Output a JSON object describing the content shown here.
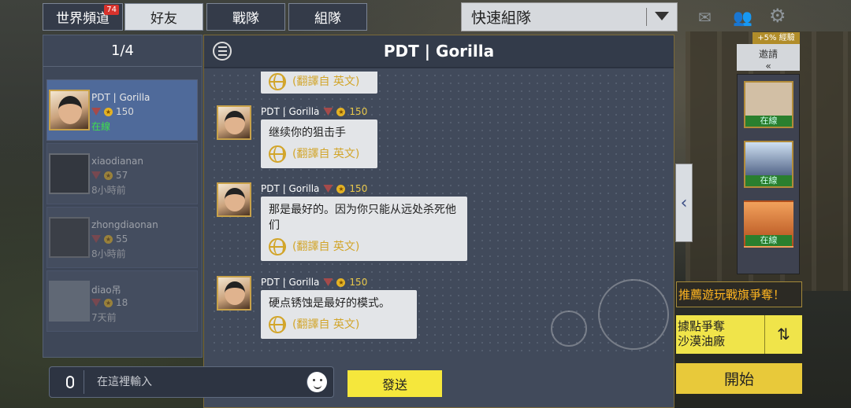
{
  "tabs": [
    {
      "label": "世界頻道",
      "badge": "74"
    },
    {
      "label": "好友"
    },
    {
      "label": "戰隊"
    },
    {
      "label": "組隊"
    }
  ],
  "quick_team": {
    "label": "快速組隊"
  },
  "friends_panel": {
    "page": "1/4",
    "friends": [
      {
        "name": "PDT | Gorilla",
        "level": "150",
        "status": "在線"
      },
      {
        "name": "xiaodianan",
        "level": "57",
        "status": "8小時前"
      },
      {
        "name": "zhongdiaonan",
        "level": "55",
        "status": "8小時前"
      },
      {
        "name": "diao吊",
        "level": "18",
        "status": "7天前"
      }
    ]
  },
  "chat": {
    "title": "PDT | Gorilla",
    "partial_translation": "(翻譯自 英文)",
    "messages": [
      {
        "sender": "PDT | Gorilla",
        "level": "150",
        "text": "继续你的狙击手",
        "translation": "(翻譯自 英文)"
      },
      {
        "sender": "PDT | Gorilla",
        "level": "150",
        "text": "那是最好的。因为你只能从远处杀死他们",
        "translation": "(翻譯自 英文)"
      },
      {
        "sender": "PDT | Gorilla",
        "level": "150",
        "text": "硬点锈蚀是最好的模式。",
        "translation": "(翻譯自 英文)"
      }
    ],
    "input_placeholder": "在這裡輸入",
    "send_label": "發送"
  },
  "right": {
    "exp_bonus": "+5% 經驗",
    "invite_label": "邀請",
    "invite_arrow": "«",
    "party_status": [
      "在線",
      "在線",
      "在線"
    ],
    "promo": "推薦遊玩戰旗爭奪！",
    "mode_line1": "據點爭奪",
    "mode_line2": "沙漠油廠",
    "start_label": "開始"
  },
  "colors": {
    "accent_yellow": "#f5e73c",
    "online_green": "#3ee04b",
    "level_gold": "#e9c84b",
    "translate_gold": "#d2a52a"
  }
}
